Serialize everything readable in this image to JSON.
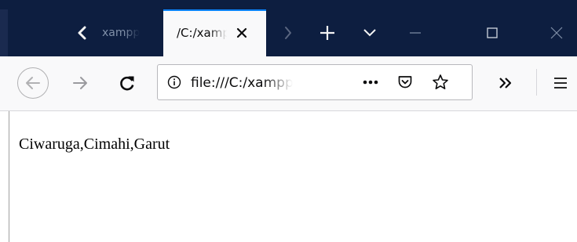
{
  "window": {
    "tabs": [
      {
        "title": "xampp",
        "active": false
      },
      {
        "title": "/C:/xampp",
        "active": true
      }
    ],
    "controls": [
      "scroll-left",
      "scroll-right",
      "new-tab",
      "list-all-tabs",
      "minimize",
      "maximize",
      "close"
    ]
  },
  "navbar": {
    "url": "file:///C:/xampp",
    "buttons": [
      "back",
      "forward",
      "reload",
      "page-actions",
      "pocket",
      "bookmark",
      "overflow",
      "menu"
    ]
  },
  "page": {
    "body_text": "Ciwaruga,Cimahi,Garut"
  },
  "colors": {
    "tabstrip": "#0d1e40",
    "active_tab_accent": "#0a84ff",
    "toolbar": "#f9f9fa"
  }
}
